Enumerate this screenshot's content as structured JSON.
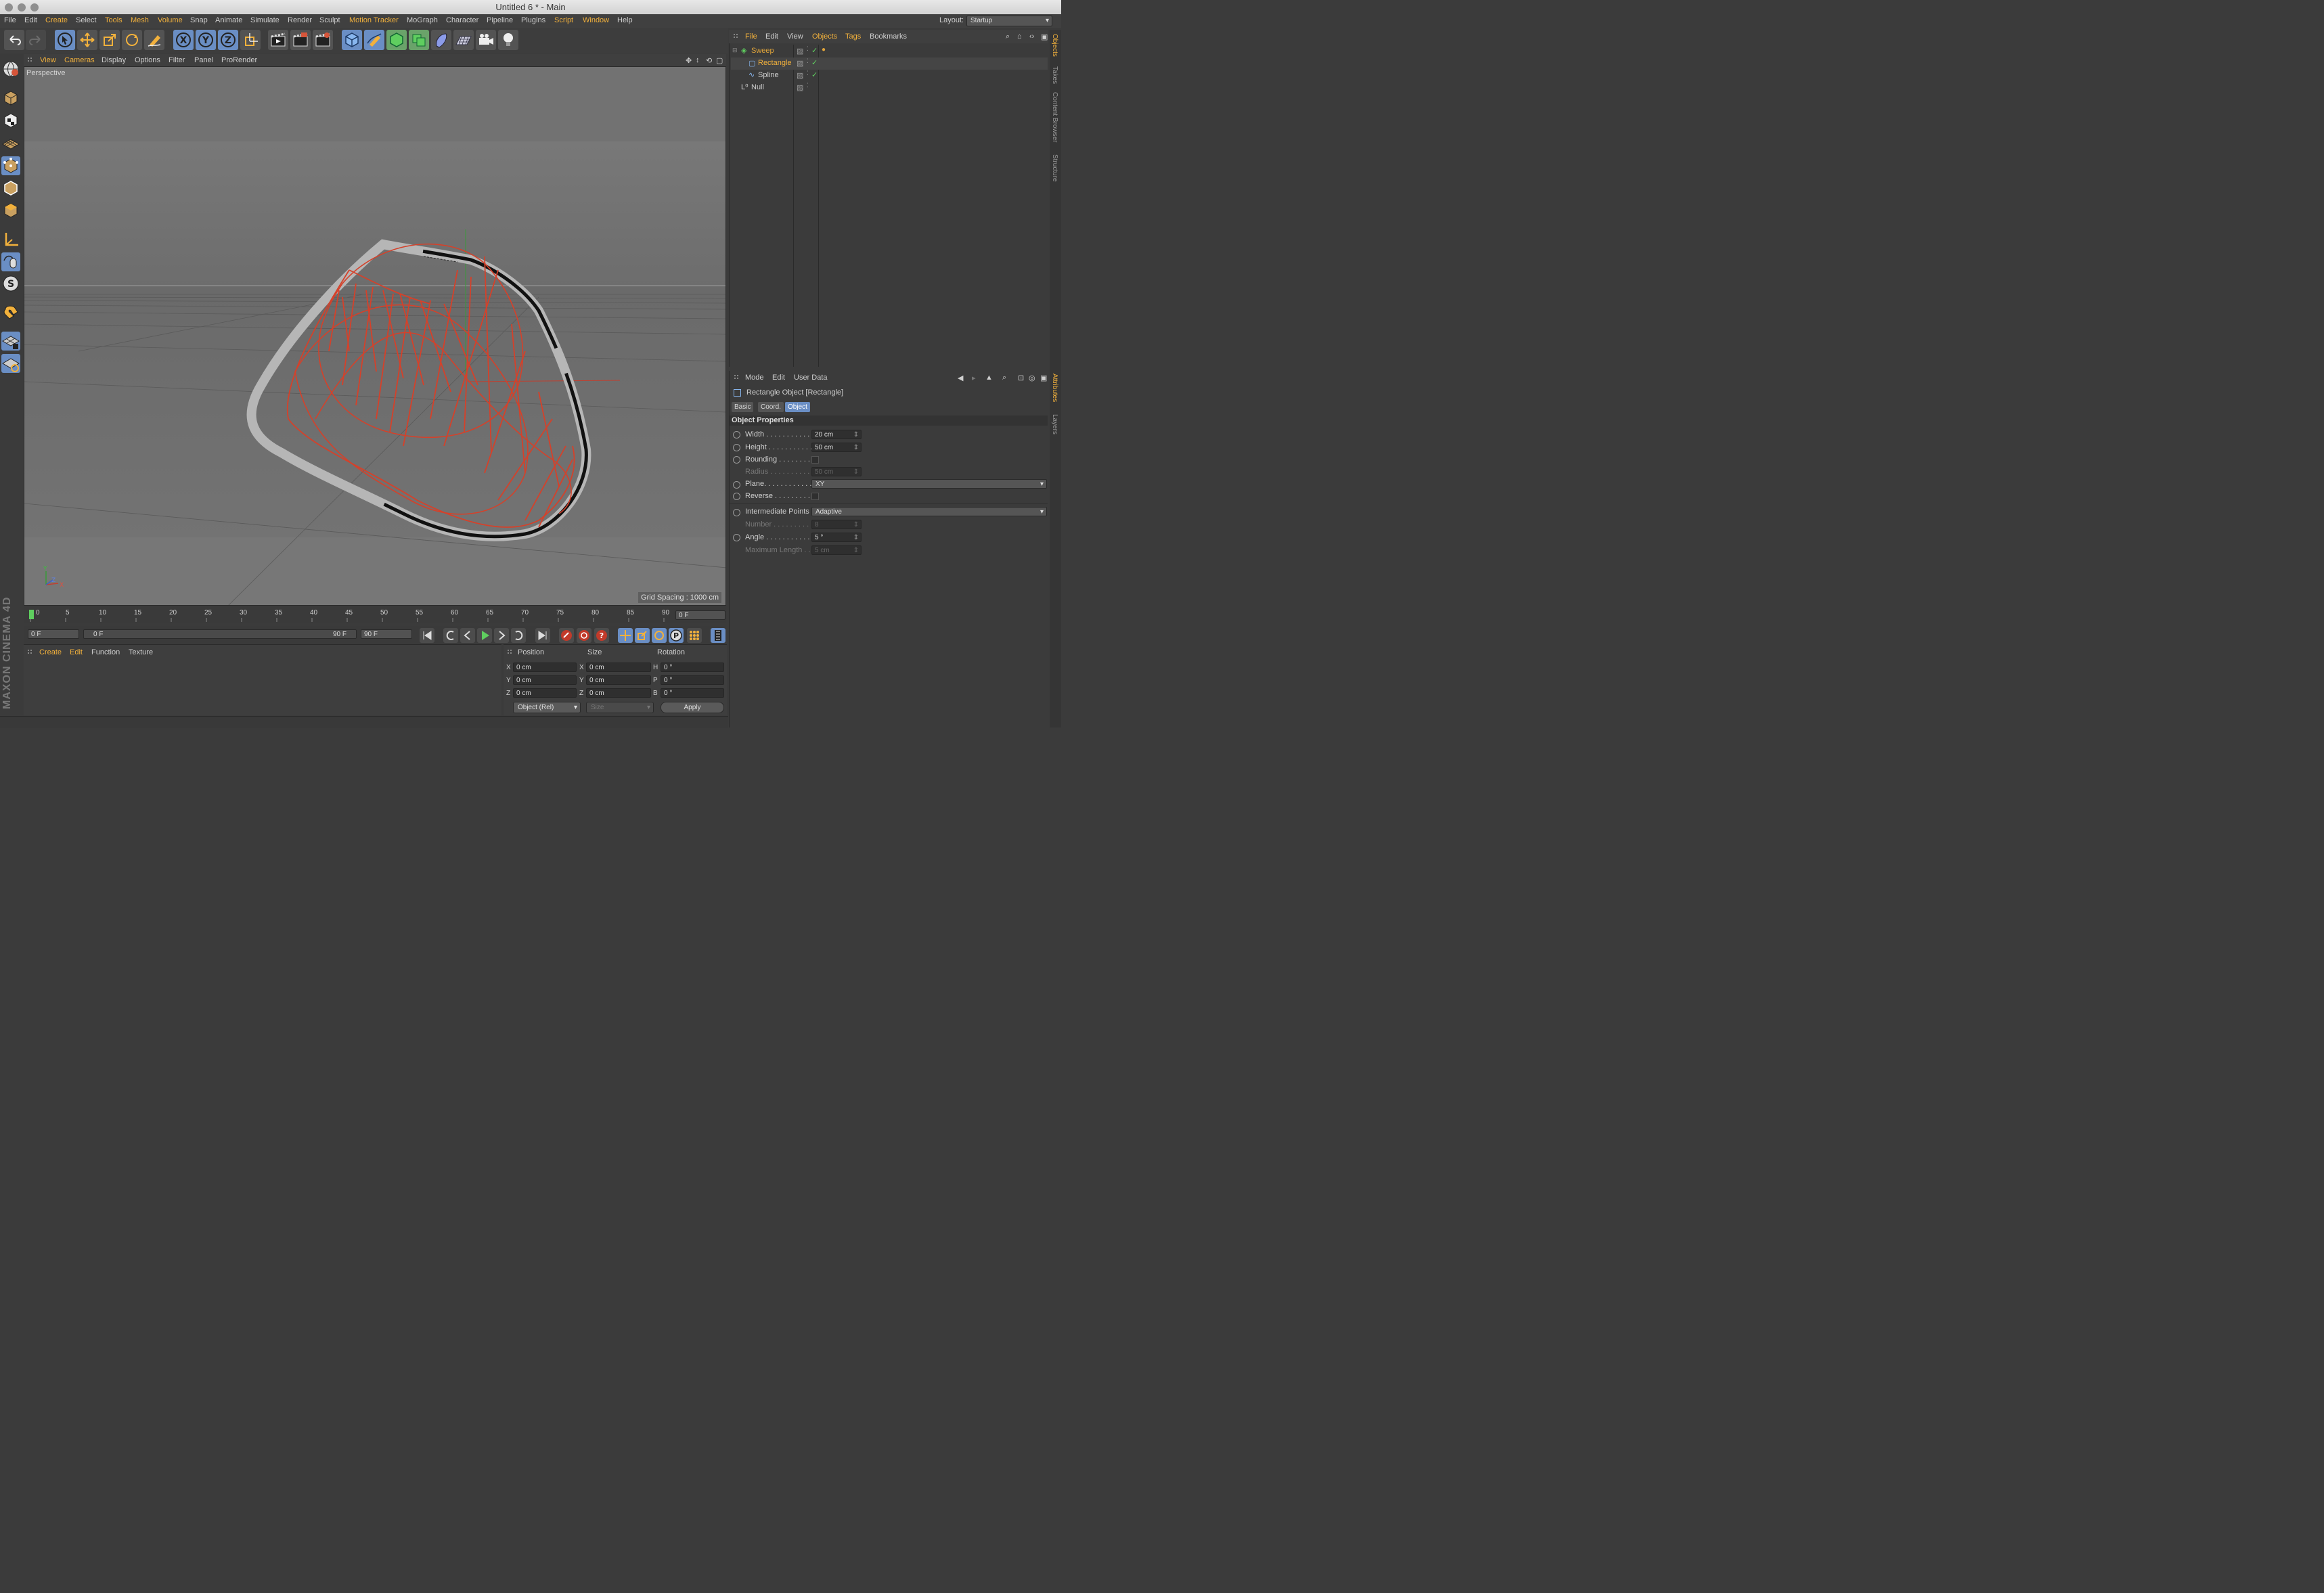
{
  "window": {
    "title": "Untitled 6 * - Main"
  },
  "menubar": {
    "items": [
      "File",
      "Edit",
      "Create",
      "Select",
      "Tools",
      "Mesh",
      "Volume",
      "Snap",
      "Animate",
      "Simulate",
      "Render",
      "Sculpt",
      "Motion Tracker",
      "MoGraph",
      "Character",
      "Pipeline",
      "Plugins",
      "Script",
      "Window",
      "Help"
    ],
    "layout_label": "Layout:",
    "layout_value": "Startup"
  },
  "viewport": {
    "menu": [
      "View",
      "Cameras",
      "Display",
      "Options",
      "Filter",
      "Panel",
      "ProRender"
    ],
    "camera_label": "Perspective",
    "grid_spacing": "Grid Spacing : 1000 cm",
    "axis_labels": {
      "y": "Y",
      "z": "Z",
      "x": "X"
    }
  },
  "timeline": {
    "ticks": [
      "0",
      "5",
      "10",
      "15",
      "20",
      "25",
      "30",
      "35",
      "40",
      "45",
      "50",
      "55",
      "60",
      "65",
      "70",
      "75",
      "80",
      "85",
      "90"
    ],
    "current_frame": "0 F",
    "start_frame": "0 F",
    "range_start": "0 F",
    "range_end": "90 F",
    "end_frame": "90 F"
  },
  "material_panel": {
    "menu": [
      "Create",
      "Edit",
      "Function",
      "Texture"
    ]
  },
  "coords": {
    "headers": {
      "position": "Position",
      "size": "Size",
      "rotation": "Rotation"
    },
    "rows": [
      {
        "axis": "X",
        "pos": "0 cm",
        "size_axis": "X",
        "size": "0 cm",
        "rot_axis": "H",
        "rot": "0 °"
      },
      {
        "axis": "Y",
        "pos": "0 cm",
        "size_axis": "Y",
        "size": "0 cm",
        "rot_axis": "P",
        "rot": "0 °"
      },
      {
        "axis": "Z",
        "pos": "0 cm",
        "size_axis": "Z",
        "size": "0 cm",
        "rot_axis": "B",
        "rot": "0 °"
      }
    ],
    "mode": "Object (Rel)",
    "size_mode": "Size",
    "apply": "Apply"
  },
  "objects_panel": {
    "menu": [
      "File",
      "Edit",
      "View",
      "Objects",
      "Tags",
      "Bookmarks"
    ],
    "tree": [
      {
        "name": "Sweep",
        "color": "#e0a43a"
      },
      {
        "name": "Rectangle",
        "color": "#f2b13c"
      },
      {
        "name": "Spline",
        "color": "#cfcfcf"
      },
      {
        "name": "Null",
        "color": "#cfcfcf"
      }
    ]
  },
  "attributes_panel": {
    "menu": [
      "Mode",
      "Edit",
      "User Data"
    ],
    "object_title": "Rectangle Object [Rectangle]",
    "tabs": [
      "Basic",
      "Coord.",
      "Object"
    ],
    "section": "Object Properties",
    "props": {
      "width_label": "Width . . . . . . . . . . . .",
      "width": "20 cm",
      "height_label": "Height . . . . . . . . . . .",
      "height": "50 cm",
      "rounding_label": "Rounding . . . . . . . .",
      "radius_label": "Radius . . . . . . . . . . .",
      "radius": "50 cm",
      "plane_label": "Plane. . . . . . . . . . . . .",
      "plane": "XY",
      "reverse_label": "Reverse . . . . . . . . . .",
      "ip_label": "Intermediate Points",
      "ip": "Adaptive",
      "number_label": "Number . . . . . . . . . .",
      "number": "8",
      "angle_label": "Angle . . . . . . . . . . . .",
      "angle": "5 °",
      "maxlen_label": "Maximum Length . .",
      "maxlen": "5 cm"
    }
  },
  "right_tabs": [
    "Objects",
    "Takes",
    "Content Browser",
    "Structure",
    "Attributes",
    "Layers"
  ],
  "brand": "MAXON CINEMA 4D"
}
